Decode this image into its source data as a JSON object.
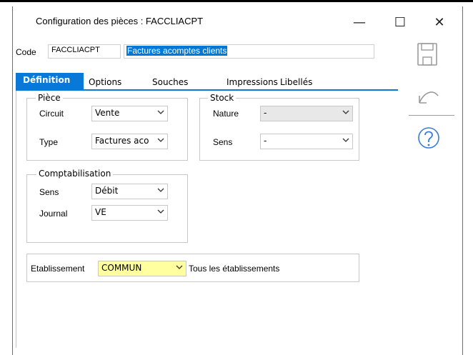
{
  "window": {
    "title": "Configuration des pièces : FACCLIACPT",
    "controls": {
      "minimize": "—",
      "maximize": "☐",
      "close": "✕"
    }
  },
  "code": {
    "label": "Code",
    "value": "FACCLIACPT",
    "description": "Factures acomptes clients"
  },
  "tabs": [
    {
      "label": "Définition",
      "active": true
    },
    {
      "label": "Options"
    },
    {
      "label": "Souches"
    },
    {
      "label": "Impressions"
    },
    {
      "label": "Libellés"
    }
  ],
  "piece": {
    "legend": "Pièce",
    "circuit_label": "Circuit",
    "circuit_value": "Vente",
    "type_label": "Type",
    "type_value": "Factures aco"
  },
  "stock": {
    "legend": "Stock",
    "nature_label": "Nature",
    "nature_value": "-",
    "sens_label": "Sens",
    "sens_value": "-"
  },
  "comptabilisation": {
    "legend": "Comptabilisation",
    "sens_label": "Sens",
    "sens_value": "Débit",
    "journal_label": "Journal",
    "journal_value": "VE"
  },
  "etablissement": {
    "label": "Etablissement",
    "value": "COMMUN",
    "description": "Tous les établissements",
    "highlight_color": "#ffffa0"
  },
  "side_icons": [
    "save-icon",
    "undo-icon",
    "help-icon"
  ],
  "colors": {
    "accent": "#0a78d7",
    "selection": "#0078d7"
  }
}
